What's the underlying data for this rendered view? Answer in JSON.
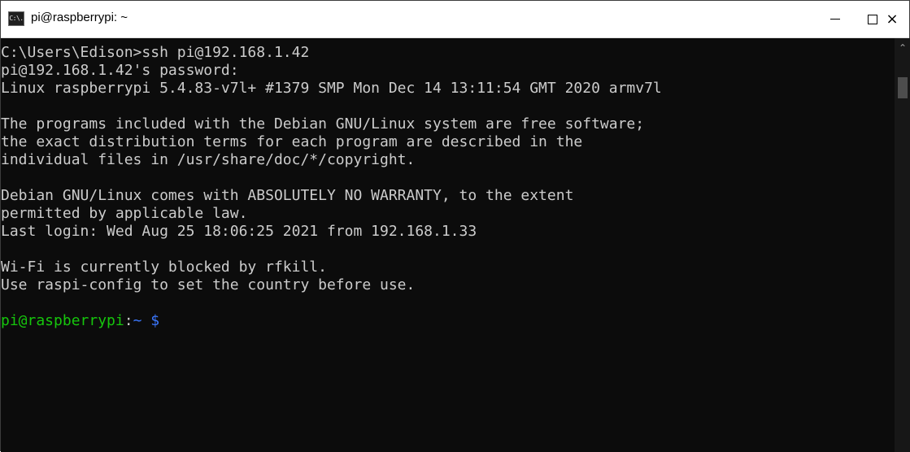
{
  "window": {
    "title": "pi@raspberrypi: ~",
    "icon_label": "C:\\.",
    "controls": {
      "minimize": "minimize-icon",
      "maximize": "maximize-icon",
      "close": "×"
    }
  },
  "console": {
    "lines": [
      "C:\\Users\\Edison>ssh pi@192.168.1.42",
      "pi@192.168.1.42's password:",
      "Linux raspberrypi 5.4.83-v7l+ #1379 SMP Mon Dec 14 13:11:54 GMT 2020 armv7l",
      "",
      "The programs included with the Debian GNU/Linux system are free software;",
      "the exact distribution terms for each program are described in the",
      "individual files in /usr/share/doc/*/copyright.",
      "",
      "Debian GNU/Linux comes with ABSOLUTELY NO WARRANTY, to the extent",
      "permitted by applicable law.",
      "Last login: Wed Aug 25 18:06:25 2021 from 192.168.1.33",
      "",
      "Wi-Fi is currently blocked by rfkill.",
      "Use raspi-config to set the country before use.",
      ""
    ],
    "prompt": {
      "user_host": "pi@raspberrypi",
      "colon": ":",
      "path": "~",
      "symbol": " $"
    }
  },
  "colors": {
    "background": "#0c0c0c",
    "text": "#cccccc",
    "prompt_user": "#16c60c",
    "prompt_path": "#3b78ff"
  },
  "scrollbar": {
    "up_arrow": "chevron-up-icon"
  }
}
